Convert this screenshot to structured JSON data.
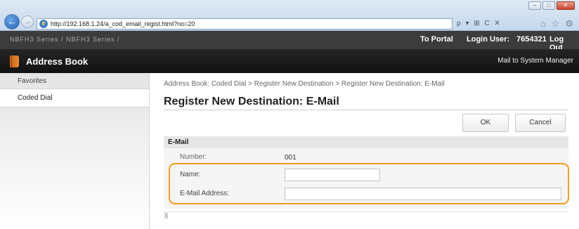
{
  "browser": {
    "url": "http://192.168.1.24/a_cod_email_regist.html?no=20",
    "address_tools": "ρ ▾ ⊞ C ✕",
    "window_controls": {
      "minimize": "–",
      "maximize": "□",
      "close": "✕"
    }
  },
  "header": {
    "model": "NBFH3 Series / NBFH3 Series /",
    "portal_link": "To Portal",
    "login_label": "Login User:",
    "login_user": "7654321",
    "logout": "Log Out"
  },
  "title_bar": {
    "title": "Address Book",
    "mail_admin": "Mail to System Manager"
  },
  "sidebar": {
    "items": [
      {
        "label": "Favorites"
      },
      {
        "label": "Coded Dial"
      }
    ]
  },
  "main": {
    "breadcrumb": "Address Book: Coded Dial > Register New Destination > Register New Destination: E-Mail",
    "page_title": "Register New Destination: E-Mail",
    "ok_label": "OK",
    "cancel_label": "Cancel",
    "section_title": "E-Mail",
    "number_label": "Number:",
    "number_value": "001",
    "name_label": "Name:",
    "name_value": "",
    "email_label": "E-Mail Address:",
    "email_value": "",
    "scroll_top_icon": "⊼"
  },
  "colors": {
    "highlight": "#f39c1a",
    "title_bar": "#1c1c1c",
    "header_strip": "#3c3c3c"
  }
}
